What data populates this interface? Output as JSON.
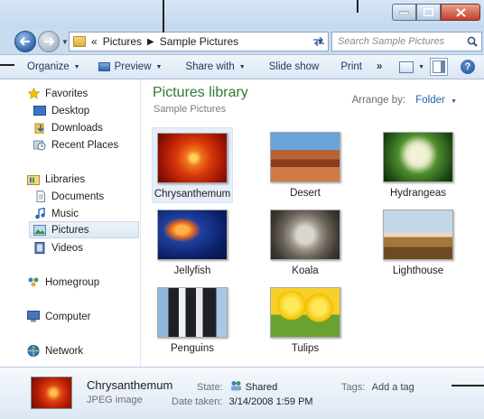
{
  "window": {
    "caption_buttons": {
      "minimize": "–",
      "maximize": "□",
      "close": "✕"
    }
  },
  "address": {
    "crumb_prefix": "«",
    "crumbs": [
      "Pictures",
      "Sample Pictures"
    ],
    "search_placeholder": "Search Sample Pictures"
  },
  "toolbar": {
    "organize": "Organize",
    "preview": "Preview",
    "share_with": "Share with",
    "slide_show": "Slide show",
    "print": "Print",
    "more": "»",
    "help": "?"
  },
  "nav": {
    "favorites": "Favorites",
    "desktop": "Desktop",
    "downloads": "Downloads",
    "recent_places": "Recent Places",
    "libraries": "Libraries",
    "documents": "Documents",
    "music": "Music",
    "pictures": "Pictures",
    "videos": "Videos",
    "homegroup": "Homegroup",
    "computer": "Computer",
    "network": "Network"
  },
  "library": {
    "title": "Pictures library",
    "subtitle": "Sample Pictures",
    "arrange_label": "Arrange by:",
    "arrange_value": "Folder"
  },
  "pictures": [
    {
      "name": "Chrysanthemum",
      "selected": true
    },
    {
      "name": "Desert"
    },
    {
      "name": "Hydrangeas"
    },
    {
      "name": "Jellyfish"
    },
    {
      "name": "Koala"
    },
    {
      "name": "Lighthouse"
    },
    {
      "name": "Penguins"
    },
    {
      "name": "Tulips"
    }
  ],
  "details": {
    "name": "Chrysanthemum",
    "type": "JPEG image",
    "state_label": "State:",
    "state_value": "Shared",
    "date_label": "Date taken:",
    "date_value": "3/14/2008 1:59 PM",
    "tags_label": "Tags:",
    "tags_value": "Add a tag"
  },
  "colors": {
    "library_title": "#2f7a32",
    "link_blue": "#1f5fad",
    "selection_bg": "#e6eef8"
  }
}
